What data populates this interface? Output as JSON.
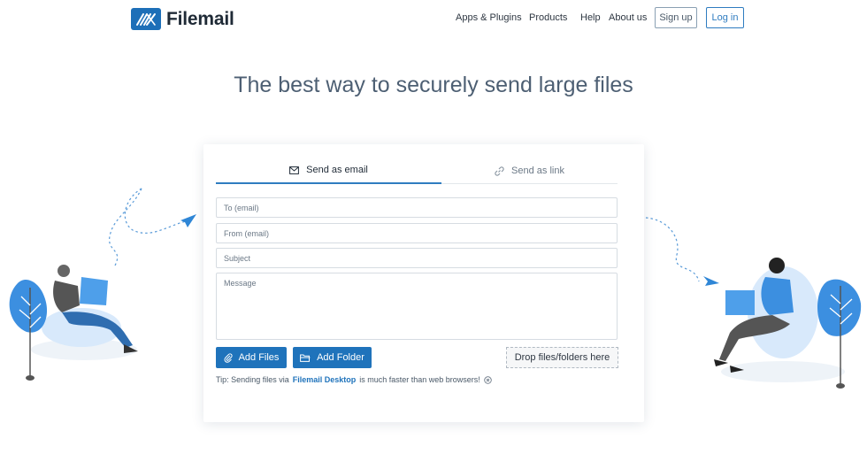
{
  "brand": {
    "name": "Filemail",
    "accent": "#1d6fb8"
  },
  "nav": {
    "apps": "Apps & Plugins",
    "products": "Products",
    "help": "Help",
    "about": "About us",
    "signup": "Sign up",
    "login": "Log in"
  },
  "hero": {
    "title": "The best way to securely send large files"
  },
  "tabs": {
    "email": "Send as email",
    "link": "Send as link"
  },
  "form": {
    "to_placeholder": "To (email)",
    "from_placeholder": "From (email)",
    "subject_placeholder": "Subject",
    "message_placeholder": "Message"
  },
  "actions": {
    "add_files": "Add Files",
    "add_folder": "Add Folder",
    "drop": "Drop files/folders here"
  },
  "tip": {
    "prefix": "Tip: Sending files via",
    "link": "Filemail Desktop",
    "suffix": "is much faster than web browsers!"
  },
  "icons": {
    "logo": "filemail-logo-icon",
    "email": "envelope-icon",
    "link": "link-icon",
    "attach": "paperclip-icon",
    "folder": "folder-icon",
    "close": "close-circle-icon"
  }
}
